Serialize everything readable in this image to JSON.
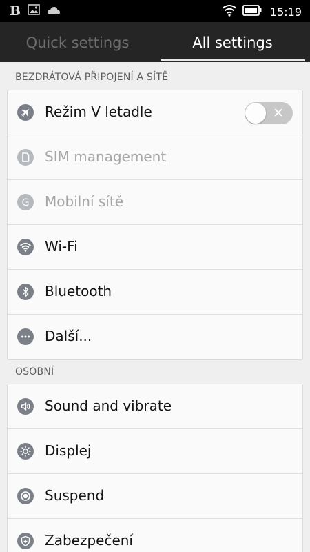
{
  "status_bar": {
    "left_icons": [
      "b-app-icon",
      "image-icon",
      "cloud-icon"
    ],
    "right_icons": [
      "wifi-icon",
      "battery-icon"
    ],
    "time": "15:19"
  },
  "tabs": [
    {
      "label": "Quick settings",
      "active": false
    },
    {
      "label": "All settings",
      "active": true
    }
  ],
  "sections": [
    {
      "header": "BEZDRÁTOVÁ PŘIPOJENÍ A SÍTĚ",
      "items": [
        {
          "label": "Režim V letadle",
          "icon": "airplane-icon",
          "toggle": "off"
        },
        {
          "label": "SIM management",
          "icon": "sim-icon",
          "disabled": true
        },
        {
          "label": "Mobilní sítě",
          "icon": "mobile-network-icon",
          "disabled": true
        },
        {
          "label": "Wi-Fi",
          "icon": "wifi-icon"
        },
        {
          "label": "Bluetooth",
          "icon": "bluetooth-icon"
        },
        {
          "label": "Další...",
          "icon": "more-icon"
        }
      ]
    },
    {
      "header": "OSOBNÍ",
      "items": [
        {
          "label": "Sound and vibrate",
          "icon": "speaker-icon"
        },
        {
          "label": "Displej",
          "icon": "brightness-icon"
        },
        {
          "label": "Suspend",
          "icon": "suspend-icon"
        },
        {
          "label": "Zabezpečení",
          "icon": "shield-icon"
        }
      ]
    }
  ],
  "colors": {
    "status_bar_bg": "#000000",
    "tab_bar_bg": "#252525",
    "tab_active_text": "#ffffff",
    "tab_inactive_text": "#6d6d6d",
    "page_bg": "#efefef",
    "icon_circle": "#7b7f88"
  }
}
